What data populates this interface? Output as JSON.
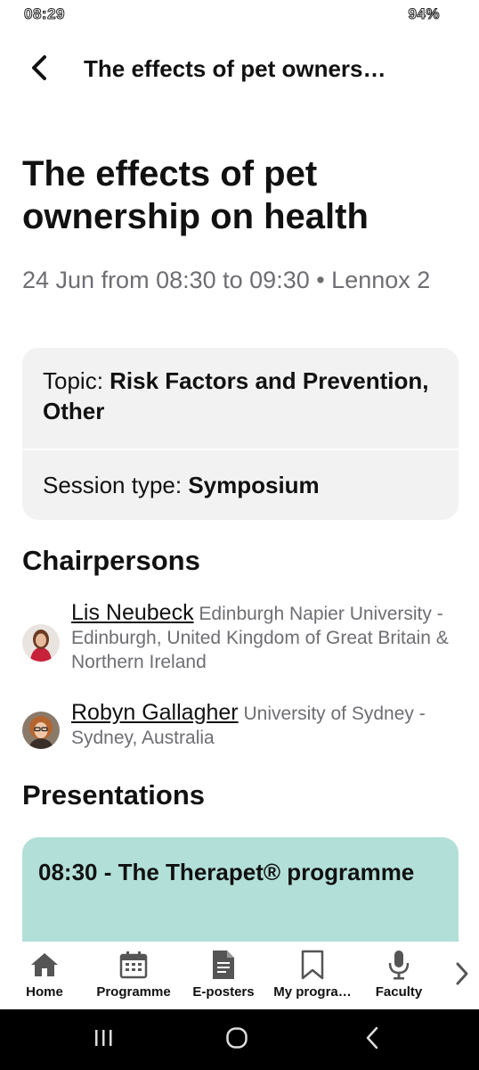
{
  "status_bar": {
    "time": "08:29",
    "battery": "94%"
  },
  "header": {
    "title": "The effects of pet owners…",
    "back_icon": "chevron-left-icon"
  },
  "session": {
    "title": "The effects of pet ownership on health",
    "meta": "24 Jun from 08:30 to 09:30 • Lennox 2",
    "topic_label": "Topic: ",
    "topic_value": "Risk Factors and Prevention, Other",
    "session_type_label": "Session type: ",
    "session_type_value": "Symposium"
  },
  "chairpersons": {
    "heading": "Chairpersons",
    "items": [
      {
        "name": "Lis Neubeck",
        "affiliation": "Edinburgh Napier University - Edinburgh, United Kingdom of Great Britain & Northern Ireland"
      },
      {
        "name": "Robyn Gallagher",
        "affiliation": "University of Sydney - Sydney, Australia"
      }
    ]
  },
  "presentations": {
    "heading": "Presentations",
    "items": [
      {
        "title": "08:30 - The Therapet® programme"
      }
    ]
  },
  "bottom_nav": {
    "items": [
      {
        "label": "Home",
        "icon": "home-icon"
      },
      {
        "label": "Programme",
        "icon": "calendar-icon"
      },
      {
        "label": "E-posters",
        "icon": "document-icon"
      },
      {
        "label": "My progra…",
        "icon": "bookmark-icon"
      },
      {
        "label": "Faculty",
        "icon": "microphone-icon"
      }
    ],
    "more_icon": "chevron-right-icon"
  },
  "colors": {
    "presentation_card": "#b2dfd8",
    "info_card": "#f2f2f2",
    "meta_text": "#6e6e73"
  }
}
